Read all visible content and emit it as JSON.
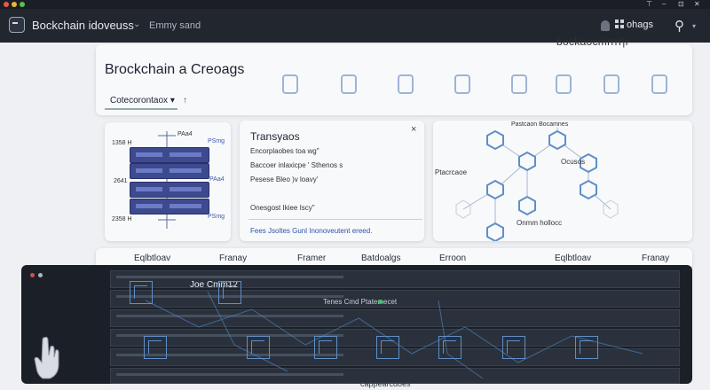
{
  "app": {
    "title": "Bockchain idoveuss",
    "subtitle": "Emmy sand",
    "apps_label": "ohags",
    "search_icon": "search-icon",
    "window_controls": [
      "⊤",
      "–",
      "⊡",
      "✕"
    ]
  },
  "page": {
    "toolbar_title": "bockaocmrrrr|r",
    "hero_title": "Brockchain a Creoags",
    "select_label": "Cotecorontaox",
    "select_chevron": "▾",
    "sort_icon": "↑"
  },
  "diagram": {
    "left_labels": [
      "1358 H",
      "2641",
      "2358 H"
    ],
    "top_label": "PAa4",
    "right_labels": [
      "PSmg",
      "PAa4",
      "PSmg"
    ]
  },
  "dialog": {
    "title": "Transyaos",
    "close": "×",
    "rows": [
      "Encorplaobes toa wg\"",
      "Baccoer inlaxicpe ' Sthenos s",
      "Pesese Bleo )v loavy'",
      "Onesgost Ikiee Iscy\""
    ],
    "link": "Fees Jsoltes Gunl Inonoveutent ereed."
  },
  "network": {
    "label_left": "Ptacrcaoe",
    "label_top": "Pastcaon Bocamnes",
    "label_mid": "Ocusos",
    "label_bottom": "Onmm hollocc"
  },
  "tabs": [
    "Eqlbtloav",
    "Franay",
    "Framer",
    "Batdoalgs",
    "Erroon",
    "Eqlbtloav",
    "Franay"
  ],
  "overlay": {
    "title": "Joe Cmm12",
    "subtitle": "Tenes Cmd Ptatemecet"
  },
  "footer": {
    "label": "cappearcdoes"
  },
  "colors": {
    "appbar": "#22262e",
    "accent": "#3e5aa7",
    "rack": "#3d4b8e",
    "hex": "#9fb3d6",
    "overlay": "#1b2028"
  }
}
